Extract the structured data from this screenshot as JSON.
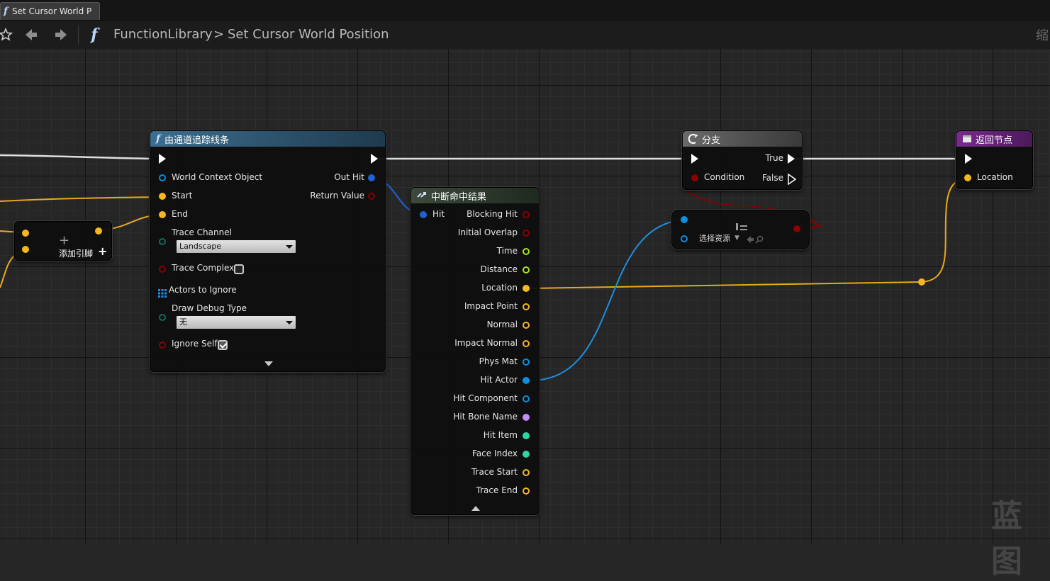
{
  "tab": {
    "icon": "f",
    "title": "Set Cursor World P"
  },
  "toolbar": {
    "fn_icon": "f",
    "breadcrumb_root": "FunctionLibrary",
    "breadcrumb_sep": ">",
    "breadcrumb_current": "Set Cursor World Position",
    "right_text": "缩"
  },
  "colors": {
    "exec": "#ffffff",
    "vector": "#f5b720",
    "object": "#0d8ee0",
    "struct": "#0a5fd1",
    "bool": "#8b0000",
    "float": "#a8e41c",
    "enum": "#0b6f5a",
    "name": "#c58cf7",
    "int": "#2fd4a3",
    "wire_blue": "#1c8fe0",
    "wire_yellow": "#e8a81d"
  },
  "make_array": {
    "add_label": "添加引脚",
    "plus": "+"
  },
  "line_trace": {
    "icon": "f",
    "title": "由通道追踪线条",
    "inputs": {
      "world_context": "World Context Object",
      "start": "Start",
      "end": "End",
      "trace_channel": "Trace Channel",
      "trace_channel_value": "Landscape",
      "trace_complex": "Trace Complex",
      "trace_complex_checked": false,
      "actors_to_ignore": "Actors to Ignore",
      "draw_debug_type": "Draw Debug Type",
      "draw_debug_value": "无",
      "ignore_self": "Ignore Self",
      "ignore_self_checked": true
    },
    "outputs": {
      "out_hit": "Out Hit",
      "return_value": "Return Value"
    }
  },
  "break_hit": {
    "title": "中断命中结果",
    "input": "Hit",
    "outputs": [
      "Blocking Hit",
      "Initial Overlap",
      "Time",
      "Distance",
      "Location",
      "Impact Point",
      "Normal",
      "Impact Normal",
      "Phys Mat",
      "Hit Actor",
      "Hit Component",
      "Hit Bone Name",
      "Hit Item",
      "Face Index",
      "Trace Start",
      "Trace End"
    ]
  },
  "branch": {
    "title": "分支",
    "condition": "Condition",
    "true_label": "True",
    "false_label": "False"
  },
  "is_valid": {
    "asset_label": "选择资源"
  },
  "return_node": {
    "title": "返回节点",
    "location": "Location"
  },
  "watermark": "蓝图"
}
